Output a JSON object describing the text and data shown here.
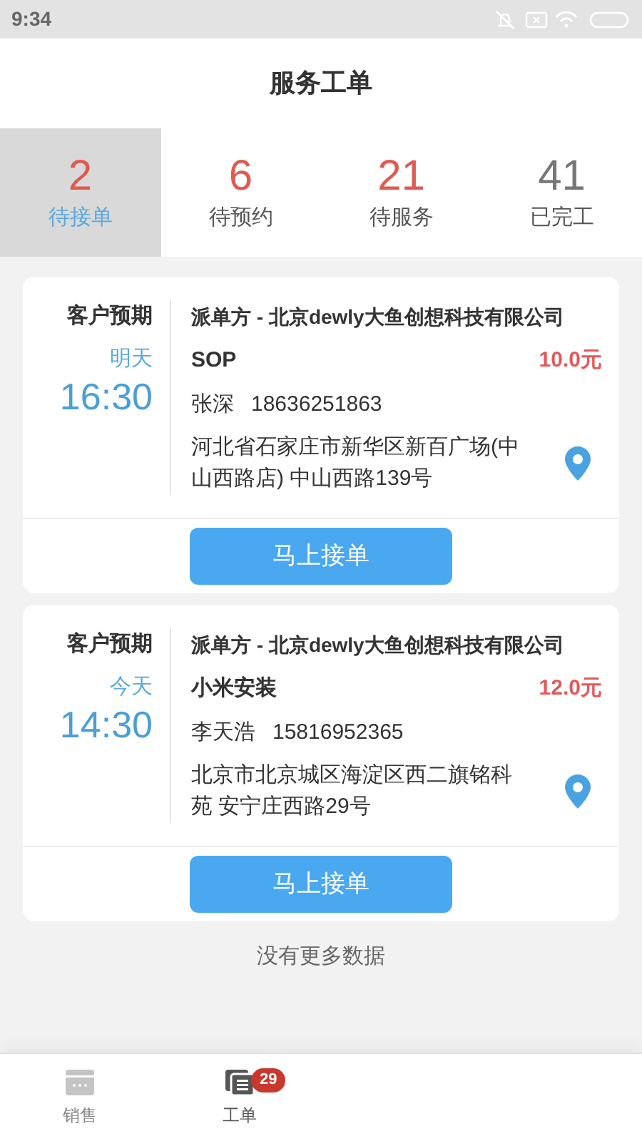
{
  "status_bar": {
    "time": "9:34"
  },
  "title": "服务工单",
  "tabs": [
    {
      "count": "2",
      "label": "待接单",
      "selected": true,
      "highlight": true
    },
    {
      "count": "6",
      "label": "待预约",
      "selected": false,
      "highlight": true
    },
    {
      "count": "21",
      "label": "待服务",
      "selected": false,
      "highlight": true
    },
    {
      "count": "41",
      "label": "已完工",
      "selected": false,
      "highlight": false
    }
  ],
  "orders": [
    {
      "expect_label": "客户预期",
      "day": "明天",
      "time": "16:30",
      "dispatcher": "派单方 - 北京dewly大鱼创想科技有限公司",
      "service": "SOP",
      "price": "10.0元",
      "contact": "张深",
      "phone": "18636251863",
      "address": "河北省石家庄市新华区新百广场(中山西路店) 中山西路139号",
      "button": "马上接单"
    },
    {
      "expect_label": "客户预期",
      "day": "今天",
      "time": "14:30",
      "dispatcher": "派单方 - 北京dewly大鱼创想科技有限公司",
      "service": "小米安装",
      "price": "12.0元",
      "contact": "李天浩",
      "phone": "15816952365",
      "address": "北京市北京城区海淀区西二旗铭科苑 安宁庄西路29号",
      "button": "马上接单"
    }
  ],
  "no_more": "没有更多数据",
  "nav": [
    {
      "label": "销售",
      "selected": false,
      "kind": "sales"
    },
    {
      "label": "工单",
      "selected": true,
      "kind": "orders",
      "badge": "29"
    }
  ]
}
